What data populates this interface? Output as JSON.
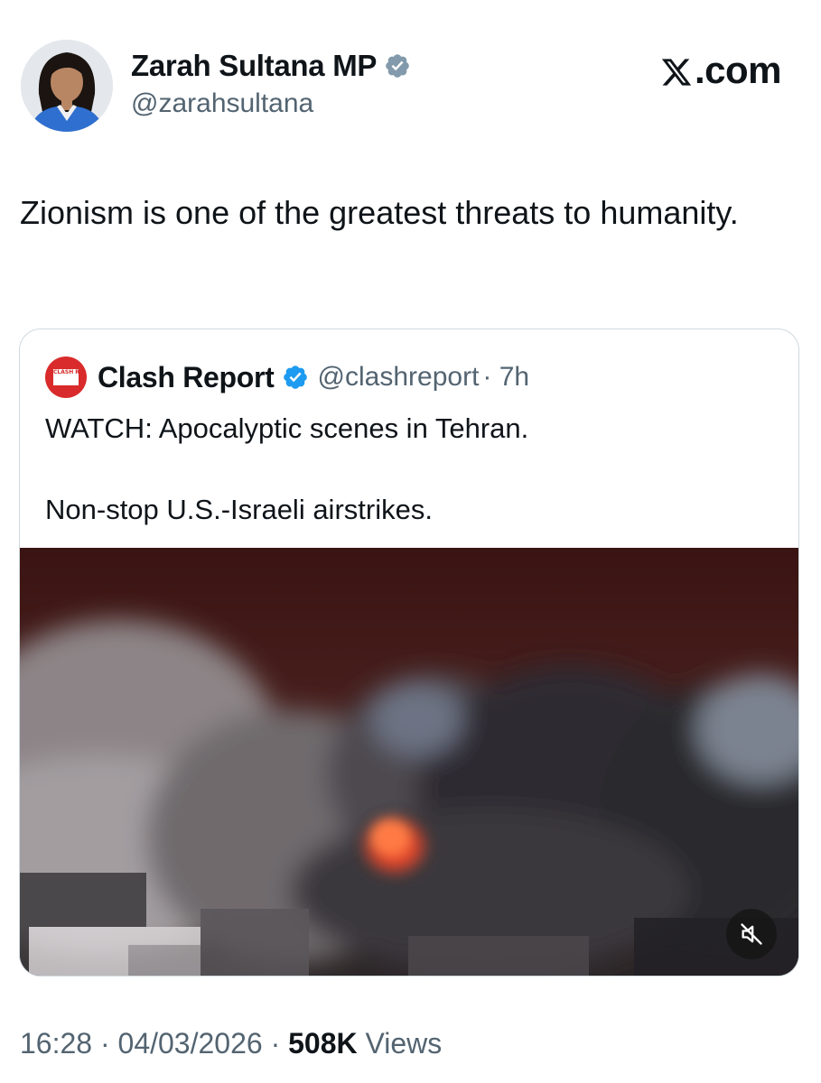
{
  "post": {
    "author": {
      "name": "Zarah Sultana MP",
      "handle": "@zarahsultana",
      "badge_color": "#829aab"
    },
    "text": "Zionism is one of the greatest threats to humanity.",
    "timestamp": "16:28 · 04/03/2026 · ",
    "views_count": "508K",
    "views_label": " Views"
  },
  "brand": {
    "label": ".com",
    "logo_icon": "x-logo-icon"
  },
  "quote": {
    "author": {
      "name": "Clash Report",
      "handle": "@clashreport",
      "time": "· 7h",
      "badge_color": "#1d9bf0",
      "avatar_text": "CLASH REPORT",
      "avatar_color": "#d92b2b"
    },
    "text_lines": [
      "WATCH: Apocalyptic scenes in Tehran.",
      "Non-stop U.S.-Israeli airstrikes."
    ],
    "media": {
      "type": "video",
      "mute_icon": "muted-speaker-icon"
    }
  }
}
